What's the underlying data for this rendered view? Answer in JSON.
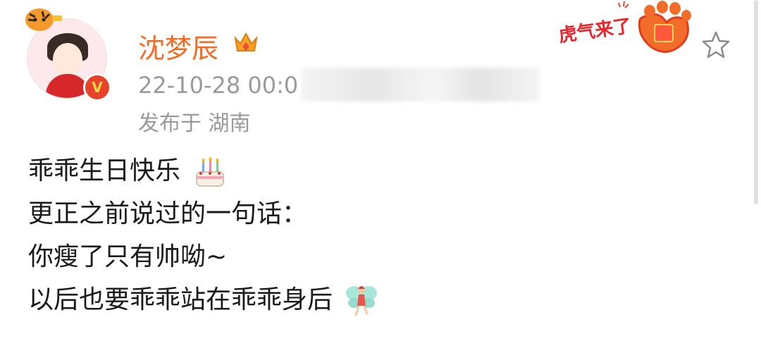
{
  "user": {
    "name": "沈梦辰",
    "timestamp_visible": "22-10-28 00:0",
    "location": "发布于 湖南"
  },
  "badge": {
    "text": "虎气来了"
  },
  "post": {
    "lines": [
      "乖乖生日快乐",
      "更正之前说过的一句话：",
      "你瘦了只有帅呦~",
      "以后也要乖乖站在乖乖身后"
    ]
  },
  "icons": {
    "verified": "verified-badge-icon",
    "crown": "crown-icon",
    "star": "star-icon",
    "cake": "birthday-cake-icon",
    "fairy": "fairy-icon"
  },
  "colors": {
    "name": "#f26b22",
    "meta": "#9a9a9a",
    "text": "#1a1a1a",
    "verified": "#e8432a"
  }
}
